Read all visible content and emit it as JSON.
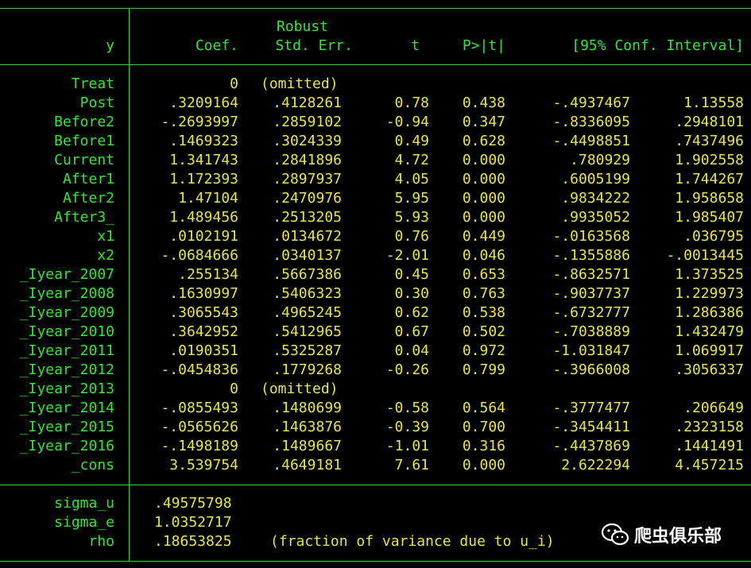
{
  "colors": {
    "label": "#34e534",
    "value": "#e6e64a",
    "rule": "#2bd92b",
    "background": "#000000"
  },
  "header": {
    "depvar": "y",
    "robust": "Robust",
    "coef": "Coef.",
    "stderr": "Std. Err.",
    "t": "t",
    "p": "P>|t|",
    "ci": "[95% Conf. Interval]"
  },
  "rows": [
    {
      "name": "Treat",
      "coef": "0",
      "se": "(omitted)",
      "t": "",
      "p": "",
      "lo": "",
      "hi": ""
    },
    {
      "name": "Post",
      "coef": ".3209164",
      "se": ".4128261",
      "t": "0.78",
      "p": "0.438",
      "lo": "-.4937467",
      "hi": "1.13558"
    },
    {
      "name": "Before2",
      "coef": "-.2693997",
      "se": ".2859102",
      "t": "-0.94",
      "p": "0.347",
      "lo": "-.8336095",
      "hi": ".2948101"
    },
    {
      "name": "Before1",
      "coef": ".1469323",
      "se": ".3024339",
      "t": "0.49",
      "p": "0.628",
      "lo": "-.4498851",
      "hi": ".7437496"
    },
    {
      "name": "Current",
      "coef": "1.341743",
      "se": ".2841896",
      "t": "4.72",
      "p": "0.000",
      "lo": ".780929",
      "hi": "1.902558"
    },
    {
      "name": "After1",
      "coef": "1.172393",
      "se": ".2897937",
      "t": "4.05",
      "p": "0.000",
      "lo": ".6005199",
      "hi": "1.744267"
    },
    {
      "name": "After2",
      "coef": "1.47104",
      "se": ".2470976",
      "t": "5.95",
      "p": "0.000",
      "lo": ".9834222",
      "hi": "1.958658"
    },
    {
      "name": "After3_",
      "coef": "1.489456",
      "se": ".2513205",
      "t": "5.93",
      "p": "0.000",
      "lo": ".9935052",
      "hi": "1.985407"
    },
    {
      "name": "x1",
      "coef": ".0102191",
      "se": ".0134672",
      "t": "0.76",
      "p": "0.449",
      "lo": "-.0163568",
      "hi": ".036795"
    },
    {
      "name": "x2",
      "coef": "-.0684666",
      "se": ".0340137",
      "t": "-2.01",
      "p": "0.046",
      "lo": "-.1355886",
      "hi": "-.0013445"
    },
    {
      "name": "_Iyear_2007",
      "coef": ".255134",
      "se": ".5667386",
      "t": "0.45",
      "p": "0.653",
      "lo": "-.8632571",
      "hi": "1.373525"
    },
    {
      "name": "_Iyear_2008",
      "coef": ".1630997",
      "se": ".5406323",
      "t": "0.30",
      "p": "0.763",
      "lo": "-.9037737",
      "hi": "1.229973"
    },
    {
      "name": "_Iyear_2009",
      "coef": ".3065543",
      "se": ".4965245",
      "t": "0.62",
      "p": "0.538",
      "lo": "-.6732777",
      "hi": "1.286386"
    },
    {
      "name": "_Iyear_2010",
      "coef": ".3642952",
      "se": ".5412965",
      "t": "0.67",
      "p": "0.502",
      "lo": "-.7038889",
      "hi": "1.432479"
    },
    {
      "name": "_Iyear_2011",
      "coef": ".0190351",
      "se": ".5325287",
      "t": "0.04",
      "p": "0.972",
      "lo": "-1.031847",
      "hi": "1.069917"
    },
    {
      "name": "_Iyear_2012",
      "coef": "-.0454836",
      "se": ".1779268",
      "t": "-0.26",
      "p": "0.799",
      "lo": "-.3966008",
      "hi": ".3056337"
    },
    {
      "name": "_Iyear_2013",
      "coef": "0",
      "se": "(omitted)",
      "t": "",
      "p": "",
      "lo": "",
      "hi": ""
    },
    {
      "name": "_Iyear_2014",
      "coef": "-.0855493",
      "se": ".1480699",
      "t": "-0.58",
      "p": "0.564",
      "lo": "-.3777477",
      "hi": ".206649"
    },
    {
      "name": "_Iyear_2015",
      "coef": "-.0565626",
      "se": ".1463876",
      "t": "-0.39",
      "p": "0.700",
      "lo": "-.3454411",
      "hi": ".2323158"
    },
    {
      "name": "_Iyear_2016",
      "coef": "-.1498189",
      "se": ".1489667",
      "t": "-1.01",
      "p": "0.316",
      "lo": "-.4437869",
      "hi": ".1441491"
    },
    {
      "name": "_cons",
      "coef": "3.539754",
      "se": ".4649181",
      "t": "7.61",
      "p": "0.000",
      "lo": "2.622294",
      "hi": "4.457215"
    }
  ],
  "stats": [
    {
      "name": "sigma_u",
      "value": ".49575798"
    },
    {
      "name": "sigma_e",
      "value": "1.0352717"
    },
    {
      "name": "rho",
      "value": ".18653825",
      "note": "(fraction of variance due to u_i)"
    }
  ],
  "watermark": {
    "text": "爬虫俱乐部",
    "icon": "wechat-icon"
  }
}
